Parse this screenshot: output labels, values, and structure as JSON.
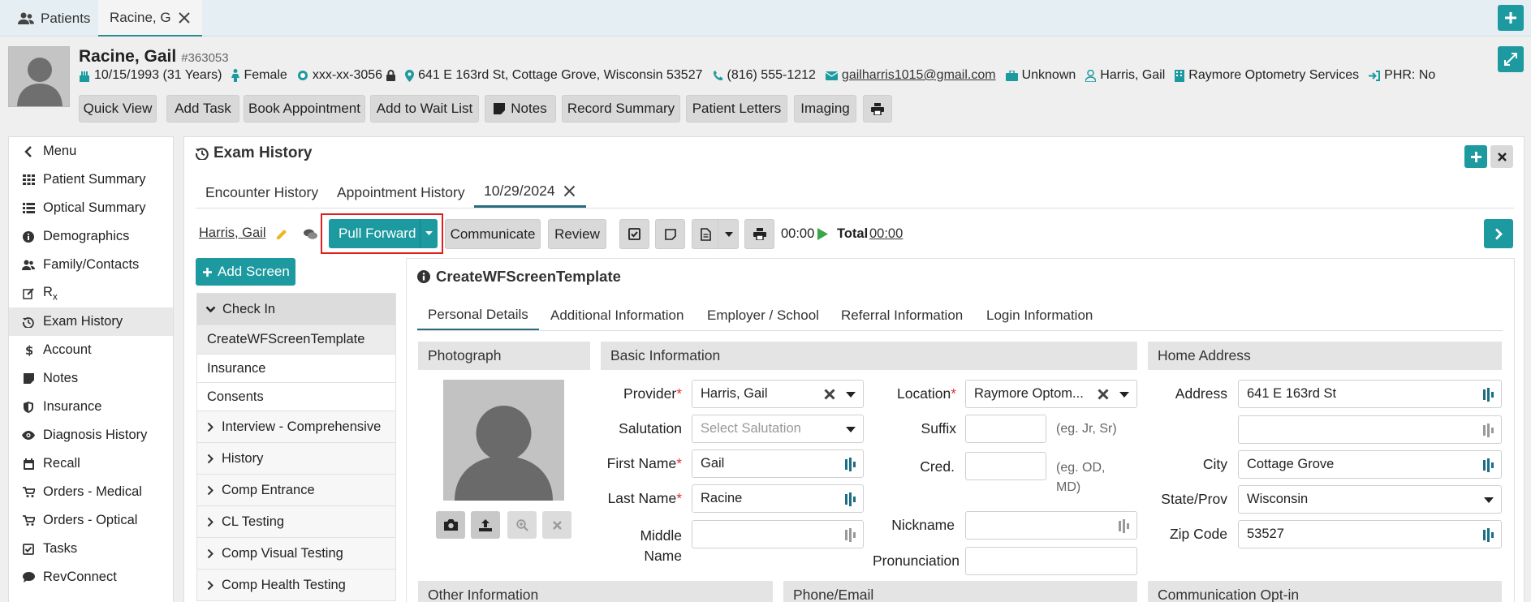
{
  "top_tabs": {
    "patients_label": "Patients",
    "active_tab_label": "Racine, G"
  },
  "patient": {
    "name": "Racine, Gail",
    "id": "#363053",
    "dob": "10/15/1993 (31 Years)",
    "gender": "Female",
    "ssn": "xxx-xx-3056",
    "address": "641 E 163rd St, Cottage Grove, Wisconsin 53527",
    "phone": "(816) 555-1212",
    "email": "gailharris1015@gmail.com",
    "employment": "Unknown",
    "provider": "Harris, Gail",
    "location": "Raymore Optometry Services",
    "phr": "PHR: No"
  },
  "header_buttons": {
    "quick_view": "Quick View",
    "add_task": "Add Task",
    "book_appointment": "Book Appointment",
    "add_to_wait_list": "Add to Wait List",
    "notes": "Notes",
    "record_summary": "Record Summary",
    "patient_letters": "Patient Letters",
    "imaging": "Imaging"
  },
  "sidebar": {
    "items": [
      {
        "label": "Menu",
        "icon": "chevron-left-icon"
      },
      {
        "label": "Patient Summary",
        "icon": "grid-icon"
      },
      {
        "label": "Optical Summary",
        "icon": "list-icon"
      },
      {
        "label": "Demographics",
        "icon": "info-circle-icon"
      },
      {
        "label": "Family/Contacts",
        "icon": "users-icon"
      },
      {
        "label": "R",
        "sub": "x",
        "icon": "edit-icon"
      },
      {
        "label": "Exam History",
        "icon": "history-icon"
      },
      {
        "label": "Account",
        "icon": "dollar-icon"
      },
      {
        "label": "Notes",
        "icon": "note-icon"
      },
      {
        "label": "Insurance",
        "icon": "shield-icon"
      },
      {
        "label": "Diagnosis History",
        "icon": "eye-icon"
      },
      {
        "label": "Recall",
        "icon": "calendar-icon"
      },
      {
        "label": "Orders - Medical",
        "icon": "cart-icon"
      },
      {
        "label": "Orders - Optical",
        "icon": "cart-icon"
      },
      {
        "label": "Tasks",
        "icon": "check-square-icon"
      },
      {
        "label": "RevConnect",
        "icon": "chat-icon"
      }
    ]
  },
  "exam": {
    "title": "Exam History",
    "tabs": {
      "encounter_history": "Encounter History",
      "appointment_history": "Appointment History",
      "date_tab": "10/29/2024"
    },
    "provider_link": "Harris, Gail",
    "pull_forward": "Pull Forward",
    "communicate": "Communicate",
    "review": "Review",
    "timer": "00:00",
    "total_label": "Total",
    "total_value": "00:00",
    "add_screen": "Add Screen"
  },
  "screens": {
    "group_check_in": "Check In",
    "check_in_items": [
      "CreateWFScreenTemplate",
      "Insurance",
      "Consents"
    ],
    "groups": [
      "Interview - Comprehensive",
      "History",
      "Comp Entrance",
      "CL Testing",
      "Comp Visual Testing",
      "Comp Health Testing"
    ]
  },
  "form": {
    "title": "CreateWFScreenTemplate",
    "tabs": [
      "Personal Details",
      "Additional Information",
      "Employer / School",
      "Referral Information",
      "Login Information"
    ],
    "sections": {
      "photograph": "Photograph",
      "basic_information": "Basic Information",
      "home_address": "Home Address",
      "other_information": "Other Information",
      "phone_email": "Phone/Email",
      "communication_opt_in": "Communication Opt-in"
    },
    "labels": {
      "provider": "Provider",
      "salutation": "Salutation",
      "first_name": "First Name",
      "last_name": "Last Name",
      "middle": "Middle",
      "name": "Name",
      "location": "Location",
      "suffix": "Suffix",
      "cred": "Cred.",
      "nickname": "Nickname",
      "pronunciation": "Pronunciation",
      "address": "Address",
      "city": "City",
      "state_prov": "State/Prov",
      "zip_code": "Zip Code"
    },
    "values": {
      "provider": "Harris, Gail",
      "salutation_placeholder": "Select Salutation",
      "first_name": "Gail",
      "last_name": "Racine",
      "middle_name": "",
      "location": "Raymore Optom...",
      "suffix": "",
      "cred": "",
      "nickname": "",
      "pronunciation": "",
      "address1": "641 E 163rd St",
      "address2": "",
      "city": "Cottage Grove",
      "state": "Wisconsin",
      "zip": "53527"
    },
    "hints": {
      "suffix": "(eg. Jr, Sr)",
      "cred_line1": "(eg. OD,",
      "cred_line2": "MD)"
    }
  },
  "colors": {
    "accent": "#1c9aa0",
    "highlight_border": "#e01e1e",
    "required": "#dd3333"
  }
}
